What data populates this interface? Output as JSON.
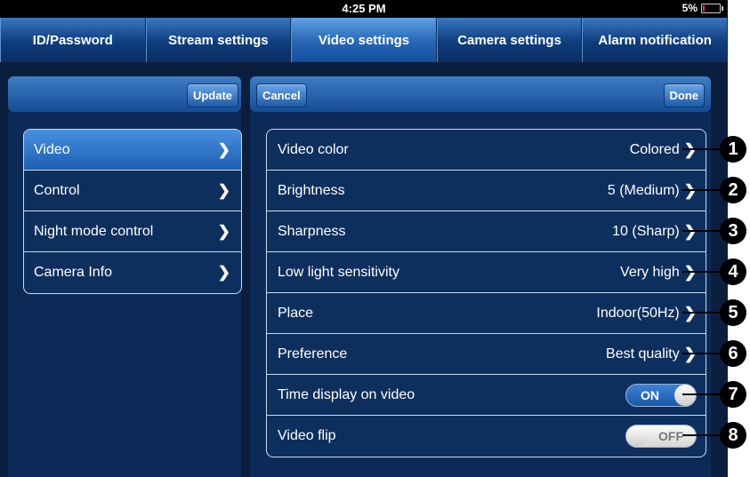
{
  "status_bar": {
    "time": "4:25 PM",
    "battery": "5%"
  },
  "tabs": [
    {
      "label": "ID/Password"
    },
    {
      "label": "Stream settings"
    },
    {
      "label": "Video settings",
      "active": true
    },
    {
      "label": "Camera settings"
    },
    {
      "label": "Alarm notification"
    }
  ],
  "left_toolbar": {
    "update_label": "Update"
  },
  "right_toolbar": {
    "cancel_label": "Cancel",
    "done_label": "Done"
  },
  "menu": [
    {
      "label": "Video",
      "active": true
    },
    {
      "label": "Control"
    },
    {
      "label": "Night mode control"
    },
    {
      "label": "Camera Info"
    }
  ],
  "settings": [
    {
      "label": "Video color",
      "value": "Colored",
      "badge": "1"
    },
    {
      "label": "Brightness",
      "value": "5 (Medium)",
      "badge": "2"
    },
    {
      "label": "Sharpness",
      "value": "10 (Sharp)",
      "badge": "3"
    },
    {
      "label": "Low light sensitivity",
      "value": "Very high",
      "badge": "4"
    },
    {
      "label": "Place",
      "value": "Indoor(50Hz)",
      "badge": "5"
    },
    {
      "label": "Preference",
      "value": "Best quality",
      "badge": "6"
    },
    {
      "label": "Time display on video",
      "toggle": "ON",
      "badge": "7"
    },
    {
      "label": "Video flip",
      "toggle": "OFF",
      "badge": "8"
    }
  ],
  "icons": {
    "chevron": "chevron-right-icon",
    "battery": "battery-icon"
  },
  "colors": {
    "accent": "#2566b5",
    "background": "#0b1e3e",
    "battery_low": "#ee3333"
  }
}
